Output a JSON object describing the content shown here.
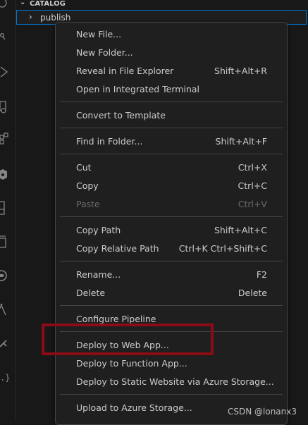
{
  "explorer": {
    "section_title": "CATALOG",
    "folder_label": "publish"
  },
  "activity_bar": {
    "icons": [
      "accounts-icon",
      "source-control-icon",
      "run-debug-icon",
      "remote-explorer-icon",
      "extensions-icon",
      "kubernetes-icon",
      "bookmarks-icon",
      "containers-icon",
      "github-icon",
      "azure-icon",
      "gitlens-icon",
      "json-icon"
    ]
  },
  "context_menu": {
    "items": [
      {
        "label": "New File...",
        "shortcut": ""
      },
      {
        "label": "New Folder...",
        "shortcut": ""
      },
      {
        "label": "Reveal in File Explorer",
        "shortcut": "Shift+Alt+R"
      },
      {
        "label": "Open in Integrated Terminal",
        "shortcut": ""
      },
      {
        "label": "Convert to Template",
        "shortcut": ""
      },
      {
        "label": "Find in Folder...",
        "shortcut": "Shift+Alt+F"
      },
      {
        "label": "Cut",
        "shortcut": "Ctrl+X"
      },
      {
        "label": "Copy",
        "shortcut": "Ctrl+C"
      },
      {
        "label": "Paste",
        "shortcut": "Ctrl+V",
        "disabled": true
      },
      {
        "label": "Copy Path",
        "shortcut": "Shift+Alt+C"
      },
      {
        "label": "Copy Relative Path",
        "shortcut": "Ctrl+K Ctrl+Shift+C"
      },
      {
        "label": "Rename...",
        "shortcut": "F2"
      },
      {
        "label": "Delete",
        "shortcut": "Delete"
      },
      {
        "label": "Configure Pipeline",
        "shortcut": ""
      },
      {
        "label": "Deploy to Web App...",
        "shortcut": ""
      },
      {
        "label": "Deploy to Function App...",
        "shortcut": ""
      },
      {
        "label": "Deploy to Static Website via Azure Storage...",
        "shortcut": ""
      },
      {
        "label": "Upload to Azure Storage...",
        "shortcut": ""
      }
    ]
  },
  "annotation": {
    "highlight_color": "#8b0c16"
  },
  "watermark": "CSDN @lonanx3",
  "colors": {
    "accent": "#0078d4",
    "menu_bg": "#1f1f1f",
    "text": "#cccccc",
    "disabled_text": "#6b6b6b"
  }
}
